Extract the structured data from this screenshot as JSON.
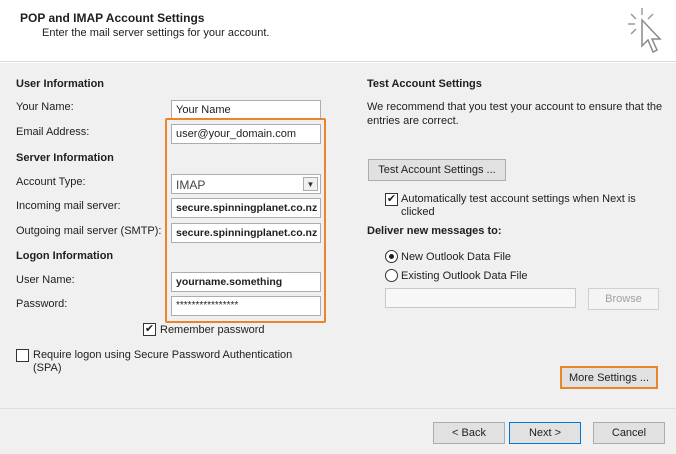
{
  "header": {
    "title": "POP and IMAP Account Settings",
    "subtitle": "Enter the mail server settings for your account."
  },
  "user_info": {
    "heading": "User Information",
    "name_label": "Your Name:",
    "name_value": "Your Name",
    "email_label": "Email Address:",
    "email_value": "user@your_domain.com"
  },
  "server_info": {
    "heading": "Server Information",
    "account_type_label": "Account Type:",
    "account_type_value": "IMAP",
    "incoming_label": "Incoming mail server:",
    "incoming_value": "secure.spinningplanet.co.nz",
    "outgoing_label": "Outgoing mail server (SMTP):",
    "outgoing_value": "secure.spinningplanet.co.nz"
  },
  "logon_info": {
    "heading": "Logon Information",
    "username_label": "User Name:",
    "username_value": "yourname.something",
    "password_label": "Password:",
    "password_value": "****************",
    "remember_label": "Remember password",
    "remember_checked": true,
    "spa_label": "Require logon using Secure Password Authentication (SPA)",
    "spa_checked": false
  },
  "test": {
    "heading": "Test Account Settings",
    "description": "We recommend that you test your account to ensure that the entries are correct.",
    "button_label": "Test Account Settings ...",
    "auto_test_label": "Automatically test account settings when Next is clicked",
    "auto_test_checked": true
  },
  "deliver": {
    "heading": "Deliver new messages to:",
    "new_file_label": "New Outlook Data File",
    "existing_file_label": "Existing Outlook Data File",
    "selected": "new",
    "browse_label": "Browse",
    "path_value": ""
  },
  "more_settings_label": "More Settings ...",
  "footer": {
    "back_label": "< Back",
    "next_label": "Next >",
    "cancel_label": "Cancel"
  },
  "colors": {
    "highlight": "#e8862a",
    "panel_bg": "#f0f0f0",
    "primary_border": "#0078d7"
  },
  "icons": {
    "header_icon": "click-cursor-icon",
    "checkmark": "✔"
  }
}
